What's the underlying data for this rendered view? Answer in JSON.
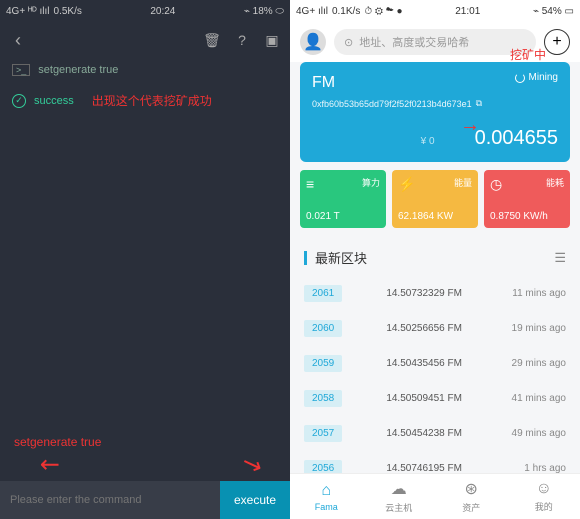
{
  "left": {
    "status": {
      "signal": "4G+ ᴴᴰ ılıl",
      "speed": "0.5K/s",
      "time": "20:24",
      "battery": "⌁ 18% ⬭"
    },
    "cmd": "setgenerate true",
    "success": "success",
    "annotations": {
      "success_note": "出现这个代表挖矿成功",
      "hint": "setgenerate true"
    },
    "input_placeholder": "Please enter the command",
    "execute": "execute"
  },
  "right": {
    "status": {
      "signal": "4G+ ılıl",
      "speed": "0.1K/s",
      "icons": "⏱ ⚙ ☁ ●",
      "time": "21:01",
      "battery": "⌁ 54% ▭"
    },
    "search_placeholder": "地址、高度或交易哈希",
    "annotations": {
      "mining": "挖矿中"
    },
    "card": {
      "title": "FM",
      "address": "0xfb60b53b65dd79f2f52f0213b4d673e1",
      "mining": "Mining",
      "balance": "0.004655",
      "prefix": "¥ 0"
    },
    "stats": [
      {
        "label": "算力",
        "value": "0.021 T",
        "color": "#29c77e",
        "icon": "≡"
      },
      {
        "label": "能量",
        "value": "62.1864 KW",
        "color": "#f5b941",
        "icon": "⚡"
      },
      {
        "label": "能耗",
        "value": "0.8750 KW/h",
        "color": "#ef5b5b",
        "icon": "◷"
      }
    ],
    "section_title": "最新区块",
    "blocks": [
      {
        "num": "2061",
        "amt": "14.50732329 FM",
        "time": "11 mins ago"
      },
      {
        "num": "2060",
        "amt": "14.50256656 FM",
        "time": "19 mins ago"
      },
      {
        "num": "2059",
        "amt": "14.50435456 FM",
        "time": "29 mins ago"
      },
      {
        "num": "2058",
        "amt": "14.50509451 FM",
        "time": "41 mins ago"
      },
      {
        "num": "2057",
        "amt": "14.50454238 FM",
        "time": "49 mins ago"
      },
      {
        "num": "2056",
        "amt": "14.50746195 FM",
        "time": "1 hrs ago"
      }
    ],
    "tabs": [
      {
        "label": "Fama",
        "icon": "⌂"
      },
      {
        "label": "云主机",
        "icon": "☁"
      },
      {
        "label": "资产",
        "icon": "⊛"
      },
      {
        "label": "我的",
        "icon": "☺"
      }
    ]
  }
}
